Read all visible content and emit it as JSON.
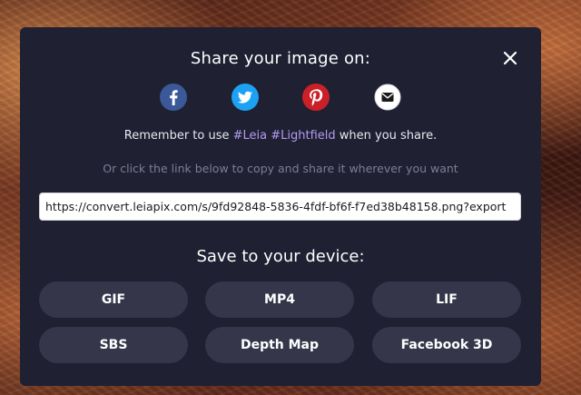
{
  "modal": {
    "title": "Share your image on:",
    "remember_prefix": "Remember to use ",
    "hashtags": "#Leia #Lightfield",
    "remember_suffix": " when you share.",
    "hint": "Or click the link below to copy and share it wherever you want",
    "share_link": "https://convert.leiapix.com/s/9fd92848-5836-4fdf-bf6f-f7ed38b48158.png?export",
    "save_title": "Save to your device:",
    "share_icons": [
      "facebook-icon",
      "twitter-icon",
      "pinterest-icon",
      "email-icon"
    ],
    "buttons": {
      "gif": "GIF",
      "mp4": "MP4",
      "lif": "LIF",
      "sbs": "SBS",
      "depth_map": "Depth Map",
      "facebook_3d": "Facebook 3D"
    }
  },
  "colors": {
    "modal_bg": "#1f2032",
    "button_bg": "#35364a",
    "hashtag": "#b39cf0",
    "hint": "#7c7e93",
    "facebook": "#3b5998",
    "twitter": "#1da1f2",
    "pinterest": "#cb2027",
    "email": "#ffffff"
  }
}
